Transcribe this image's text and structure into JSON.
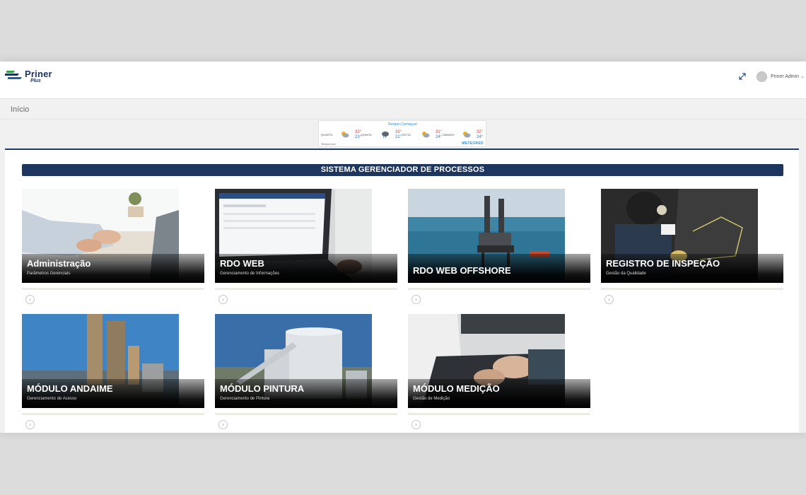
{
  "header": {
    "logo_title": "Priner",
    "logo_sub": "Plus",
    "user_name": "Priner Admin",
    "caret": "⌄"
  },
  "breadcrumb": {
    "current": "Início"
  },
  "weather": {
    "title": "Tempo Camaçari",
    "days": [
      {
        "name": "QUARTA",
        "max": "33°",
        "min": "23°"
      },
      {
        "name": "QUINTA",
        "max": "33°",
        "min": "22°"
      },
      {
        "name": "SEXTA",
        "max": "31°",
        "min": "24°"
      },
      {
        "name": "SÁBADO",
        "max": "32°",
        "min": "24°"
      }
    ],
    "footer_left": "Tempo.com",
    "footer_right": "METEORED"
  },
  "section_title": "SISTEMA GERENCIADOR DE PROCESSOS",
  "modules": [
    {
      "title": "Administração",
      "subtitle": "Parâmetros Gerenciais",
      "icon": "arrow-circle-icon"
    },
    {
      "title": "RDO WEB",
      "subtitle": "Gerenciamento de Informações",
      "icon": "arrow-circle-icon"
    },
    {
      "title": "RDO WEB OFFSHORE",
      "subtitle": "",
      "icon": "arrow-circle-icon"
    },
    {
      "title": "REGISTRO DE INSPEÇÃO",
      "subtitle": "Gestão da Qualidade",
      "icon": "arrow-circle-icon"
    },
    {
      "title": "MÓDULO ANDAIME",
      "subtitle": "Gerenciamento de Acesso",
      "icon": "arrow-circle-icon"
    },
    {
      "title": "MÓDULO PINTURA",
      "subtitle": "Gerenciamento de Pintura",
      "icon": "arrow-circle-icon"
    },
    {
      "title": "MÓDULO MEDIÇÃO",
      "subtitle": "Gestão de Medição",
      "icon": "arrow-circle-icon"
    }
  ],
  "colors": {
    "brand_navy": "#1e365e",
    "accent_blue": "#3b8fd6"
  }
}
